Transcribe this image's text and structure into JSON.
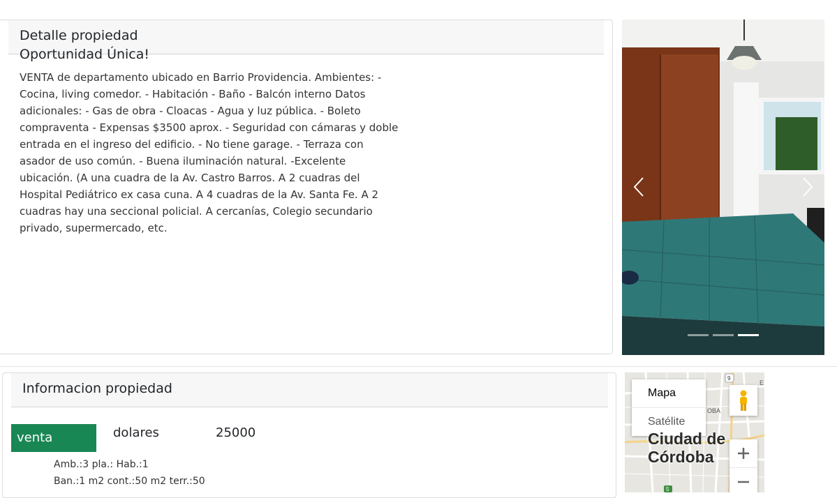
{
  "detail": {
    "header": "Detalle propiedad",
    "title": "Oportunidad Única!",
    "description": "VENTA de departamento ubicado en Barrio Providencia. Ambientes: - Cocina, living comedor. - Habitación - Baño - Balcón interno Datos adicionales: - Gas de obra - Cloacas - Agua y luz pública. - Boleto compraventa - Expensas $3500 aprox. - Seguridad con cámaras y doble entrada en el ingreso del edificio. - No tiene garage. - Terraza con asador de uso común. - Buena iluminación natural. -Excelente ubicación. (A una cuadra de la Av. Castro Barros. A 2 cuadras del Hospital Pediátrico ex casa cuna. A 4 cuadras de la Av. Santa Fe. A 2 cuadras hay una seccional policial. A cercanías, Colegio secundario privado, supermercado, etc."
  },
  "carousel": {
    "prev_icon": "chevron-left-icon",
    "next_icon": "chevron-right-icon",
    "slide_count": 3,
    "active_slide": 3
  },
  "info": {
    "header": "Informacion propiedad",
    "operation": "venta",
    "currency": "dolares",
    "price": "25000",
    "line1": "Amb.:3 pla.: Hab.:1",
    "line2": "Ban.:1 m2 cont.:50 m2 terr.:50"
  },
  "map": {
    "type_map": "Mapa",
    "type_satellite": "Satélite",
    "city_line1": "Ciudad de",
    "city_line2": "Córdoba",
    "label_oba": "OBA",
    "route_9": "9",
    "route_5": "5",
    "label_e": "E"
  },
  "colors": {
    "venta_badge": "#198754",
    "header_bg": "#f7f7f7"
  }
}
